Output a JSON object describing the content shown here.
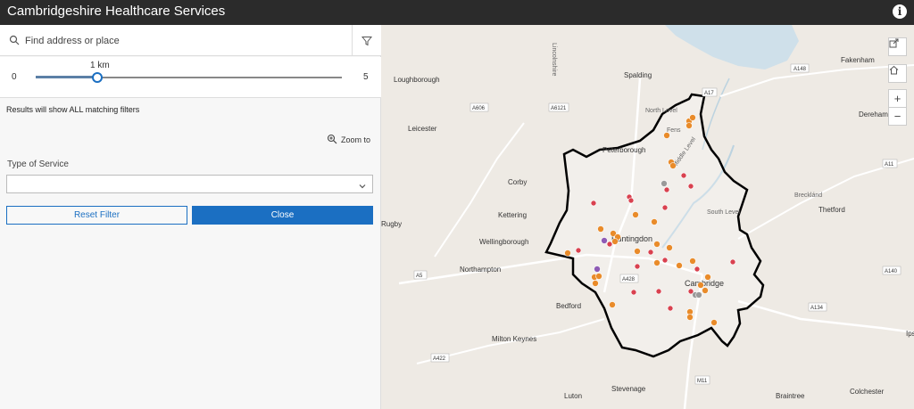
{
  "app": {
    "title": "Cambridgeshire Healthcare Services",
    "info_icon": "info-icon"
  },
  "search": {
    "placeholder": "Find address or place",
    "value": ""
  },
  "slider": {
    "min_label": "0",
    "max_label": "5",
    "value_label": "1 km",
    "value": 1,
    "min": 0,
    "max": 5
  },
  "filters": {
    "results_note": "Results will show ALL matching filters",
    "zoom_to": "Zoom to",
    "type_label": "Type of Service",
    "type_value": "",
    "reset_label": "Reset Filter",
    "close_label": "Close"
  },
  "map": {
    "places": [
      "Loughborough",
      "Spalding",
      "Fakenham",
      "Leicester",
      "Peterborough",
      "Dereham",
      "Corby",
      "Kettering",
      "Rugby",
      "Wellingborough",
      "Huntingdon",
      "Thetford",
      "Northampton",
      "Cambridge",
      "Bedford",
      "Milton Keynes",
      "Luton",
      "Stevenage",
      "Braintree",
      "Colchester",
      "Brecklánd",
      "Lincolnshire",
      "Fens",
      "South Level",
      "North Level",
      "Middle Level",
      "Ipsw"
    ],
    "roads": [
      "A148",
      "A17",
      "A606",
      "A6121",
      "A11",
      "A5",
      "A428",
      "A140",
      "A134",
      "A422",
      "M11"
    ],
    "colors": {
      "orange": "#e98b2a",
      "red": "#d9414f",
      "purple": "#8e5bb5",
      "grey": "#9a9a9a",
      "boundary": "#000000"
    }
  },
  "controls": [
    "share-icon",
    "home-icon",
    "zoom-in-button",
    "zoom-out-button"
  ]
}
